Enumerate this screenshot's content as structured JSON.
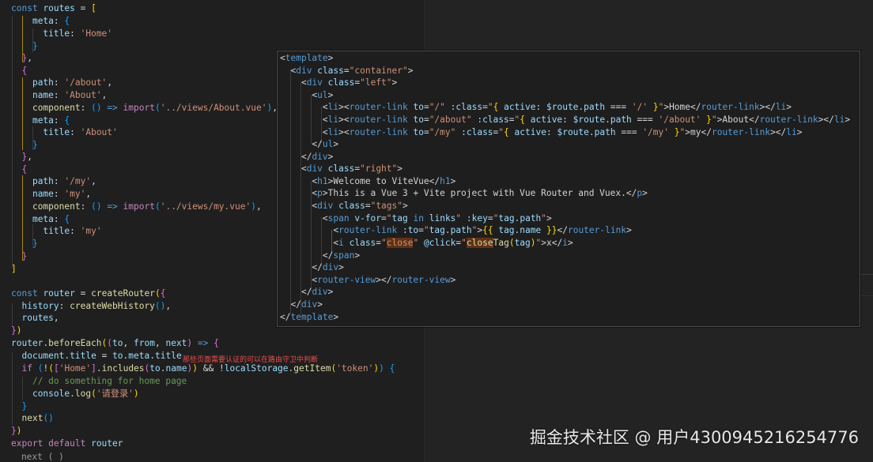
{
  "colors": {
    "background": "#1e1e1e",
    "keyword": "#569cd6",
    "control_keyword": "#c586c0",
    "variable": "#9cdcfe",
    "function": "#dcdcaa",
    "string": "#ce9178",
    "comment": "#6a9955",
    "note_red": "#f14c4c"
  },
  "left_editor": {
    "lines": [
      "const routes = [",
      "    meta: {",
      "      title: 'Home'",
      "    }",
      "  },",
      "  {",
      "    path: '/about',",
      "    name: 'About',",
      "    component: () => import('../views/About.vue'),",
      "    meta: {",
      "      title: 'About'",
      "    }",
      "  },",
      "  {",
      "    path: '/my',",
      "    name: 'my',",
      "    component: () => import('../views/my.vue'),",
      "    meta: {",
      "      title: 'my'",
      "    }",
      "  }",
      "]",
      "",
      "const router = createRouter({",
      "  history: createWebHistory(),",
      "  routes,",
      "})",
      "router.beforeEach((to, from, next) => {",
      "  document.title = to.meta.title",
      "  if (!(['Home'].includes(to.name)) && !localStorage.getItem('token')) {",
      "    // do something for home page",
      "    console.log('请登录')",
      "  }",
      "  next()",
      "})",
      "export default router"
    ],
    "annotation": "那些页面需要认证的可以在路由守卫中判断",
    "cut_line": "    next ( )"
  },
  "overlay_editor": {
    "lines": [
      "<template>",
      "  <div class=\"container\">",
      "    <div class=\"left\">",
      "      <ul>",
      "        <li><router-link to=\"/\" :class=\"{ active: $route.path === '/' }\">Home</router-link></li>",
      "        <li><router-link to=\"/about\" :class=\"{ active: $route.path === '/about' }\">About</router-link></li>",
      "        <li><router-link to=\"/my\" :class=\"{ active: $route.path === '/my' }\">my</router-link></li>",
      "      </ul>",
      "    </div>",
      "    <div class=\"right\">",
      "      <h1>Welcome to ViteVue</h1>",
      "      <p>This is a Vue 3 + Vite project with Vue Router and Vuex.</p>",
      "      <div class=\"tags\">",
      "        <span v-for=\"tag in links\" :key=\"tag.path\">",
      "          <router-link :to=\"tag.path\">{{ tag.name }}</router-link>",
      "          <i class=\"close\" @click=\"closeTag(tag)\">x</i>",
      "        </span>",
      "      </div>",
      "      <router-view></router-view>",
      "    </div>",
      "  </div>",
      "</template>"
    ]
  },
  "watermark": "掘金技术社区 @ 用户4300945216254776"
}
